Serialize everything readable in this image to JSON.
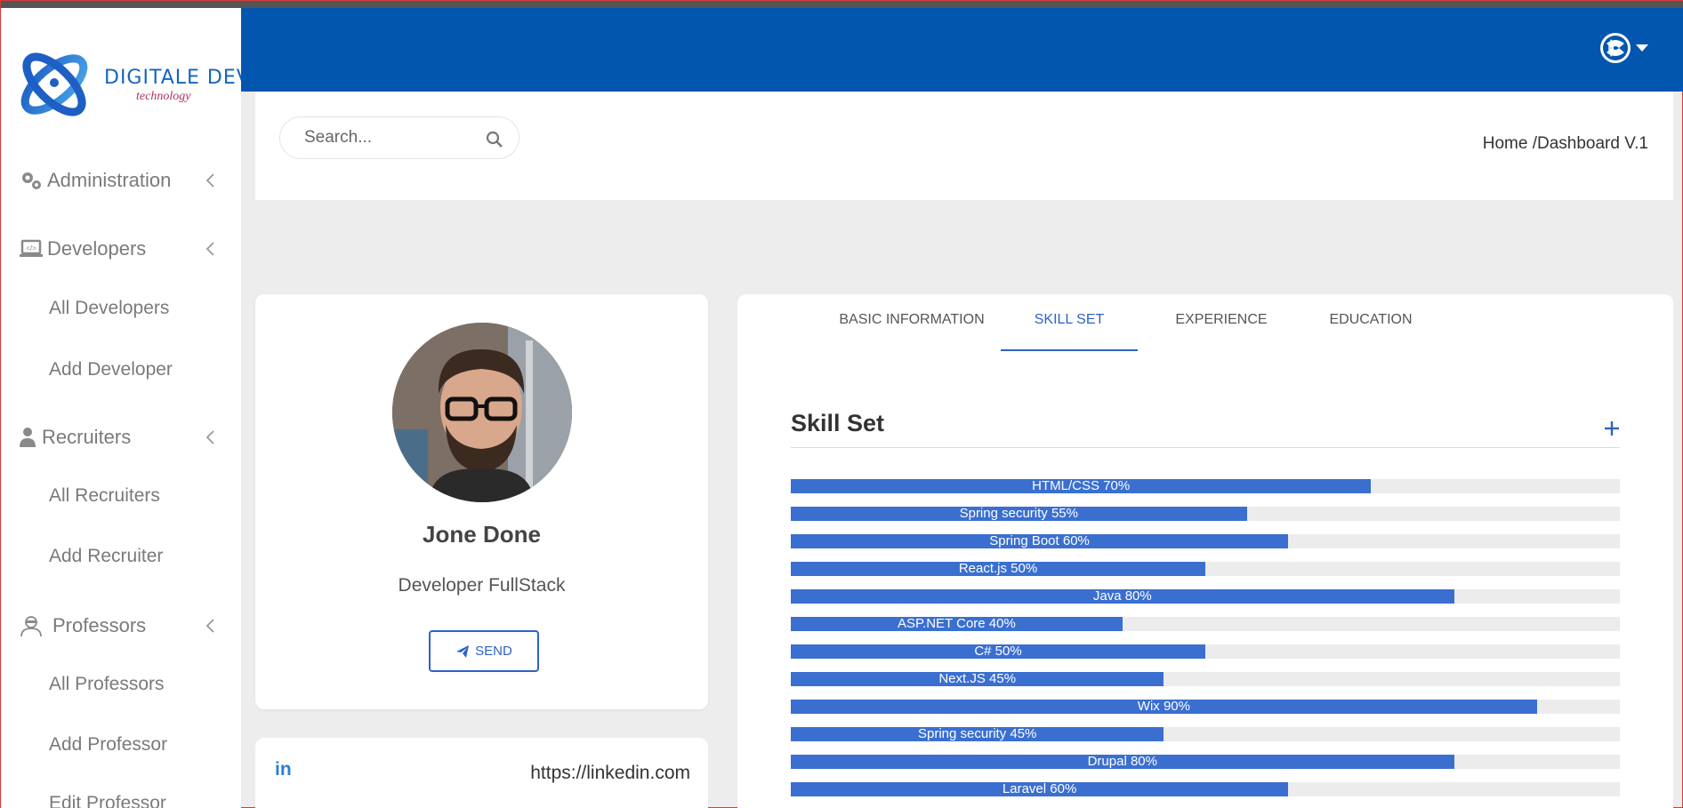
{
  "brand": {
    "name": "DIGITALE DEV",
    "tagline": "technology"
  },
  "sidebar": {
    "items": [
      {
        "label": "Administration",
        "icon": "gears-icon"
      },
      {
        "label": "Developers",
        "icon": "laptop-code-icon"
      },
      {
        "label": "All Developers"
      },
      {
        "label": "Add Developer"
      },
      {
        "label": "Recruiters",
        "icon": "user-tie-icon"
      },
      {
        "label": "All Recruiters"
      },
      {
        "label": "Add Recruiter"
      },
      {
        "label": "Professors",
        "icon": "user-secret-icon"
      },
      {
        "label": "All Professors"
      },
      {
        "label": "Add Professor"
      },
      {
        "label": "Edit Professor"
      }
    ]
  },
  "header": {
    "bg_color": "#0356ad",
    "user_menu_icon": "user-avatar-icon"
  },
  "search": {
    "placeholder": "Search..."
  },
  "breadcrumb": {
    "home": "Home",
    "separator": " /",
    "current": "Dashboard V.1"
  },
  "profile": {
    "name": "Jone Done",
    "role": "Developer FullStack",
    "send_label": "SEND",
    "linkedin_url": "https://linkedin.com",
    "linkedin_icon_text": "in"
  },
  "tabs": [
    {
      "label": "BASIC INFORMATION"
    },
    {
      "label": "SKILL SET"
    },
    {
      "label": "EXPERIENCE"
    },
    {
      "label": "EDUCATION"
    }
  ],
  "skill_section": {
    "title": "Skill Set",
    "add_label": "+",
    "skills": [
      {
        "label": "HTML/CSS 70%",
        "percent": 70
      },
      {
        "label": "Spring security 55%",
        "percent": 55
      },
      {
        "label": "Spring Boot 60%",
        "percent": 60
      },
      {
        "label": "React.js 50%",
        "percent": 50
      },
      {
        "label": "Java 80%",
        "percent": 80
      },
      {
        "label": "ASP.NET Core 40%",
        "percent": 40
      },
      {
        "label": "C# 50%",
        "percent": 50
      },
      {
        "label": "Next.JS 45%",
        "percent": 45
      },
      {
        "label": "Wix 90%",
        "percent": 90
      },
      {
        "label": "Spring security 45%",
        "percent": 45
      },
      {
        "label": "Drupal 80%",
        "percent": 80
      },
      {
        "label": "Laravel 60%",
        "percent": 60
      }
    ]
  }
}
